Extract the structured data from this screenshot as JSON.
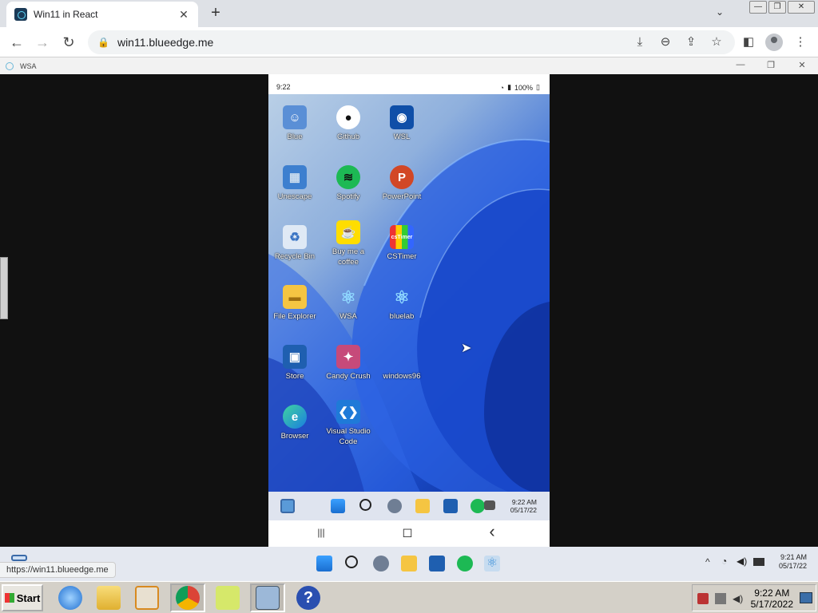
{
  "browser": {
    "tab_title": "Win11 in React",
    "tab_close": "✕",
    "new_tab": "+",
    "url": "win11.blueedge.me",
    "status_url": "https://win11.blueedge.me"
  },
  "wsa": {
    "title": "WSA",
    "minimize": "—",
    "maximize": "❐",
    "close": "✕"
  },
  "phone": {
    "time": "9:22",
    "battery": "100%",
    "clock_time": "9:22 AM",
    "clock_date": "05/17/22",
    "apps": [
      {
        "label": "Blue"
      },
      {
        "label": "Github"
      },
      {
        "label": "WSL"
      },
      {
        "label": "Unescape"
      },
      {
        "label": "Spotify"
      },
      {
        "label": "PowerPoint"
      },
      {
        "label": "Recycle Bin"
      },
      {
        "label": "Buy me a coffee"
      },
      {
        "label": "CSTimer"
      },
      {
        "label": "File Explorer"
      },
      {
        "label": "WSA"
      },
      {
        "label": "bluelab"
      },
      {
        "label": "Store"
      },
      {
        "label": "Candy Crush"
      },
      {
        "label": "windows96"
      },
      {
        "label": "Browser"
      },
      {
        "label": "Visual Studio Code"
      }
    ],
    "cstimer_badge": "csTimer",
    "nav": {
      "recents": "|||",
      "home": "◻",
      "back": "‹"
    }
  },
  "outer_taskbar": {
    "clock_time": "9:21 AM",
    "clock_date": "05/17/22",
    "chevron": "^"
  },
  "os_taskbar": {
    "start": "Start",
    "clock_time": "9:22 AM",
    "clock_date": "5/17/2022"
  },
  "colors": {
    "wallpaper_blue": "#1a4bc9",
    "taskbar": "#dfe4ef",
    "chrome_bg": "#dee1e6"
  }
}
